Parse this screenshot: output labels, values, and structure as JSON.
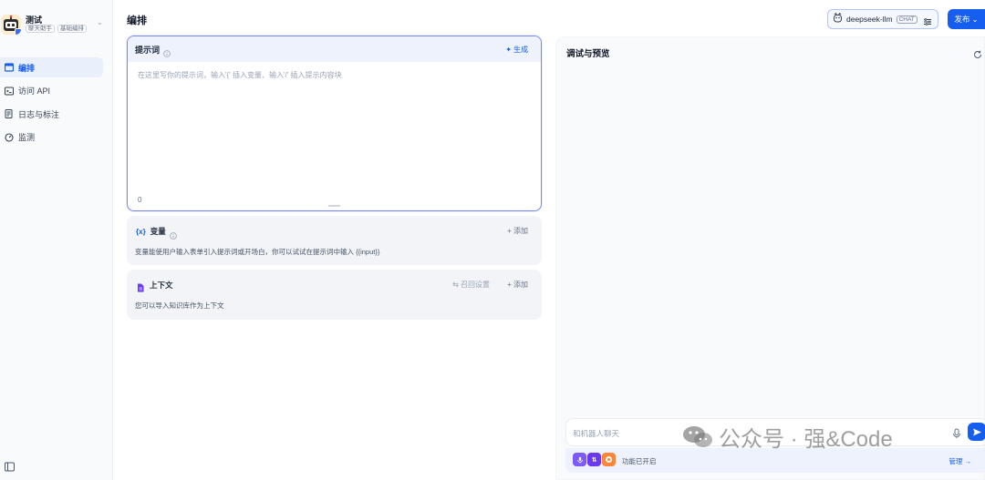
{
  "app": {
    "name": "测试",
    "tags": [
      "聊天助手",
      "基础编排"
    ]
  },
  "sidebar": {
    "items": [
      {
        "label": "编排",
        "icon": "layout-icon",
        "active": true
      },
      {
        "label": "访问 API",
        "icon": "terminal-icon",
        "active": false
      },
      {
        "label": "日志与标注",
        "icon": "document-icon",
        "active": false
      },
      {
        "label": "监测",
        "icon": "monitor-icon",
        "active": false
      }
    ]
  },
  "header": {
    "title": "编排",
    "model_name": "deepseek-llm",
    "model_badge": "CHAT",
    "publish_label": "发布"
  },
  "prompt": {
    "title": "提示词",
    "generate_label": "生成",
    "placeholder": "在这里写你的提示词，输入'{' 插入变量、输入'/' 插入提示内容块",
    "count": "0"
  },
  "variables": {
    "title": "变量",
    "add_label": "添加",
    "description": "变量能使用户输入表单引入提示词或开场白，你可以试试在提示词中输入 {{input}}"
  },
  "context": {
    "title": "上下文",
    "recall_label": "召回设置",
    "add_label": "添加",
    "description": "您可以导入知识库作为上下文"
  },
  "preview": {
    "title": "调试与预览",
    "chat_placeholder": "和机器人聊天",
    "features_label": "功能已开启",
    "manage_label": "管理"
  },
  "watermark": {
    "text": "公众号 · 强&Code"
  },
  "colors": {
    "accent": "#155eef",
    "prompt_border": "#7b88f0",
    "active_nav_bg": "#eaeffc"
  }
}
